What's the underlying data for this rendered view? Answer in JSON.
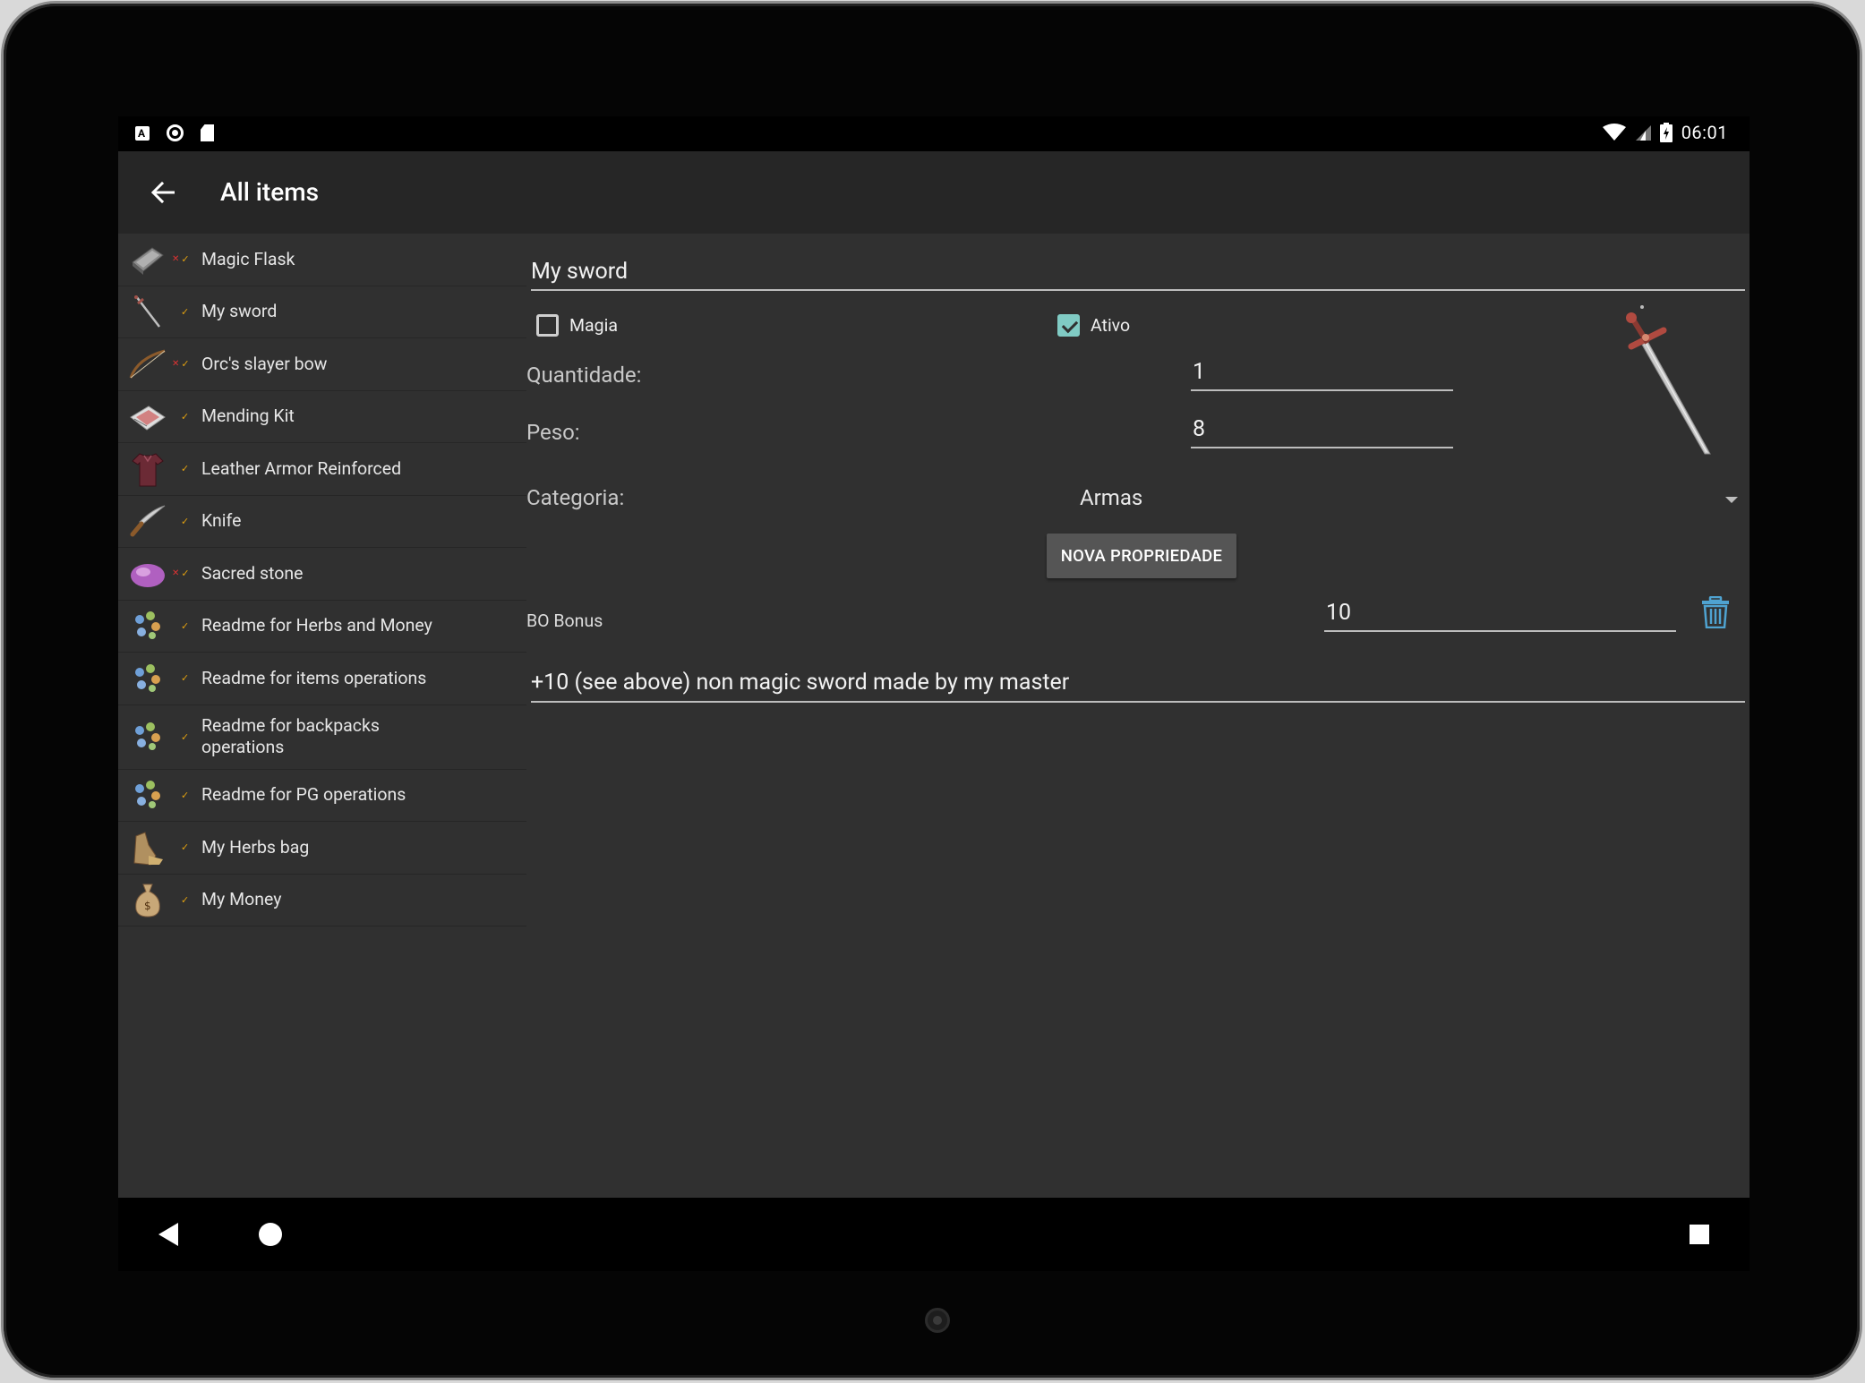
{
  "status_bar": {
    "time": "06:01",
    "left_icons": [
      "accessibility-icon",
      "record-icon",
      "sd-card-icon"
    ],
    "right_icons": [
      "wifi-icon",
      "signal-icon",
      "battery-charging-icon"
    ]
  },
  "toolbar": {
    "title": "All items",
    "back_icon": "arrow-back-icon"
  },
  "items": [
    {
      "label": "Magic Flask",
      "icon": "flask-icon",
      "magic": true,
      "active": true
    },
    {
      "label": "My sword",
      "icon": "sword-icon",
      "magic": false,
      "active": true
    },
    {
      "label": "Orc's slayer bow",
      "icon": "bow-icon",
      "magic": true,
      "active": true
    },
    {
      "label": "Mending Kit",
      "icon": "mending-kit-icon",
      "magic": false,
      "active": true
    },
    {
      "label": "Leather Armor Reinforced",
      "icon": "armor-icon",
      "magic": false,
      "active": true
    },
    {
      "label": "Knife",
      "icon": "knife-icon",
      "magic": false,
      "active": true
    },
    {
      "label": "Sacred stone",
      "icon": "stone-icon",
      "magic": true,
      "active": true
    },
    {
      "label": "Readme for Herbs and Money",
      "icon": "herbs-icon",
      "magic": false,
      "active": true
    },
    {
      "label": "Readme for items operations",
      "icon": "herbs-icon",
      "magic": false,
      "active": true
    },
    {
      "label": "Readme for backpacks operations",
      "icon": "herbs-icon",
      "magic": false,
      "active": true
    },
    {
      "label": "Readme for PG operations",
      "icon": "herbs-icon",
      "magic": false,
      "active": true
    },
    {
      "label": "My Herbs bag",
      "icon": "herbs-bag-icon",
      "magic": false,
      "active": true
    },
    {
      "label": "My Money",
      "icon": "money-bag-icon",
      "magic": false,
      "active": true
    }
  ],
  "detail": {
    "name": "My sword",
    "magia_label": "Magia",
    "magia_checked": false,
    "ativo_label": "Ativo",
    "ativo_checked": true,
    "quantidade_label": "Quantidade:",
    "quantidade_value": "1",
    "peso_label": "Peso:",
    "peso_value": "8",
    "categoria_label": "Categoria:",
    "categoria_value": "Armas",
    "nova_button": "NOVA PROPRIEDADE",
    "property": {
      "name": "BO Bonus",
      "value": "10"
    },
    "description": "+10 (see above) non magic sword made by my master",
    "image_icon": "sword-image"
  },
  "colors": {
    "accent": "#80cbc4",
    "background": "#303030",
    "toolbar": "#262626",
    "trash": "#4fa3d1"
  }
}
